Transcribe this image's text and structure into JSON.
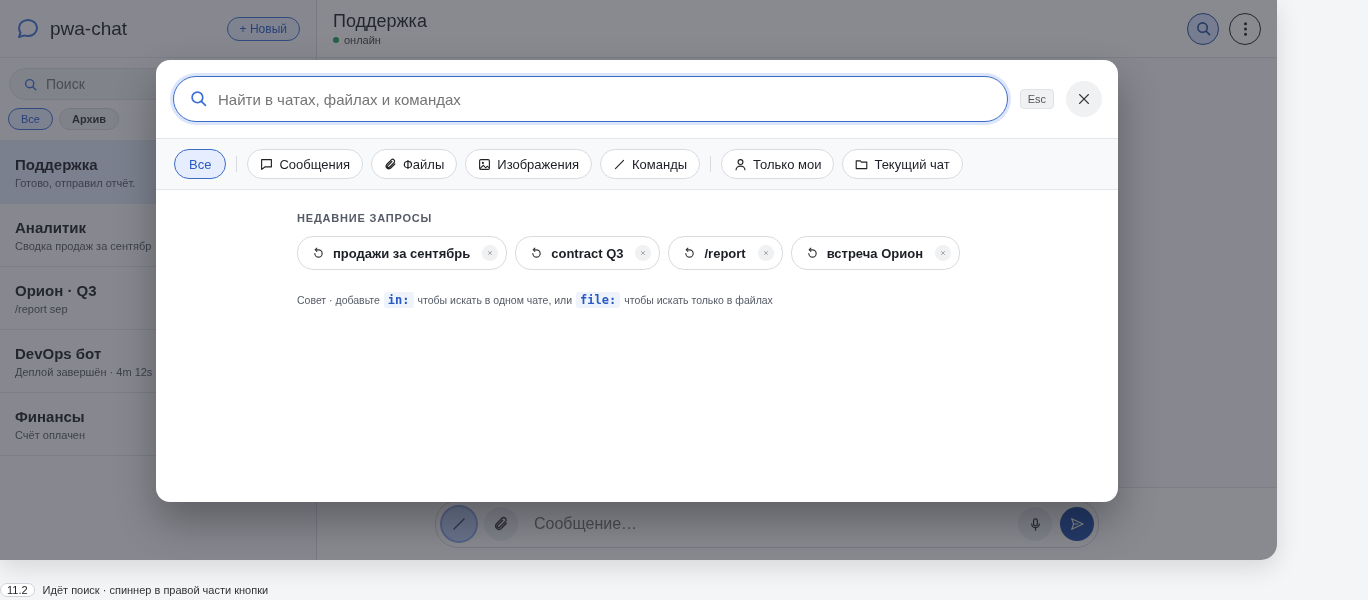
{
  "sidebar": {
    "app_name": "pwa-chat",
    "new_button": "+ Новый",
    "search": {
      "placeholder": "Поиск"
    },
    "filters": [
      {
        "label": "Все",
        "selected": true
      },
      {
        "label": "Архив",
        "selected": false
      }
    ],
    "chats": [
      {
        "name": "Поддержка",
        "preview": "Готово, отправил отчёт.",
        "selected": true
      },
      {
        "name": "Аналитик",
        "preview": "Сводка продаж за сентябр",
        "selected": false
      },
      {
        "name": "Орион · Q3",
        "preview": "/report sep",
        "selected": false
      },
      {
        "name": "DevOps бот",
        "preview": "Деплой завершён · 4m 12s",
        "selected": false
      },
      {
        "name": "Финансы",
        "preview": "Счёт оплачен",
        "selected": false
      }
    ]
  },
  "chat_header": {
    "title": "Поддержка",
    "status": "онлайн",
    "online": true,
    "search_active": true
  },
  "composer": {
    "placeholder": "Сообщение…",
    "commands_active": true
  },
  "search_dialog": {
    "placeholder": "Найти в чатах, файлах и командах",
    "esc_hint": "Esc",
    "filter_groups": [
      [
        {
          "label": "Все",
          "kind": "all",
          "selected": true
        }
      ],
      [
        {
          "label": "Сообщения",
          "kind": "message",
          "selected": false
        },
        {
          "label": "Файлы",
          "kind": "file",
          "selected": false
        },
        {
          "label": "Изображения",
          "kind": "image",
          "selected": false
        },
        {
          "label": "Команды",
          "kind": "command",
          "selected": false
        }
      ],
      [
        {
          "label": "Только мои",
          "kind": "user",
          "selected": false
        },
        {
          "label": "Текущий чат",
          "kind": "folder",
          "selected": false
        }
      ]
    ],
    "recent_heading": "НЕДАВНИЕ ЗАПРОСЫ",
    "recent": [
      "продажи за сентябрь",
      "contract Q3",
      "/report",
      "встреча Орион"
    ],
    "tip": [
      {
        "kind": "text",
        "text": "Совет · добавьте"
      },
      {
        "kind": "code",
        "text": "in:"
      },
      {
        "kind": "text",
        "text": "чтобы искать в одном чате, или"
      },
      {
        "kind": "code",
        "text": "file:"
      },
      {
        "kind": "text",
        "text": "чтобы искать только в файлах"
      }
    ]
  },
  "caption": {
    "badge": "11.2",
    "text": "Идёт поиск · спиннер в правой части кнопки"
  }
}
